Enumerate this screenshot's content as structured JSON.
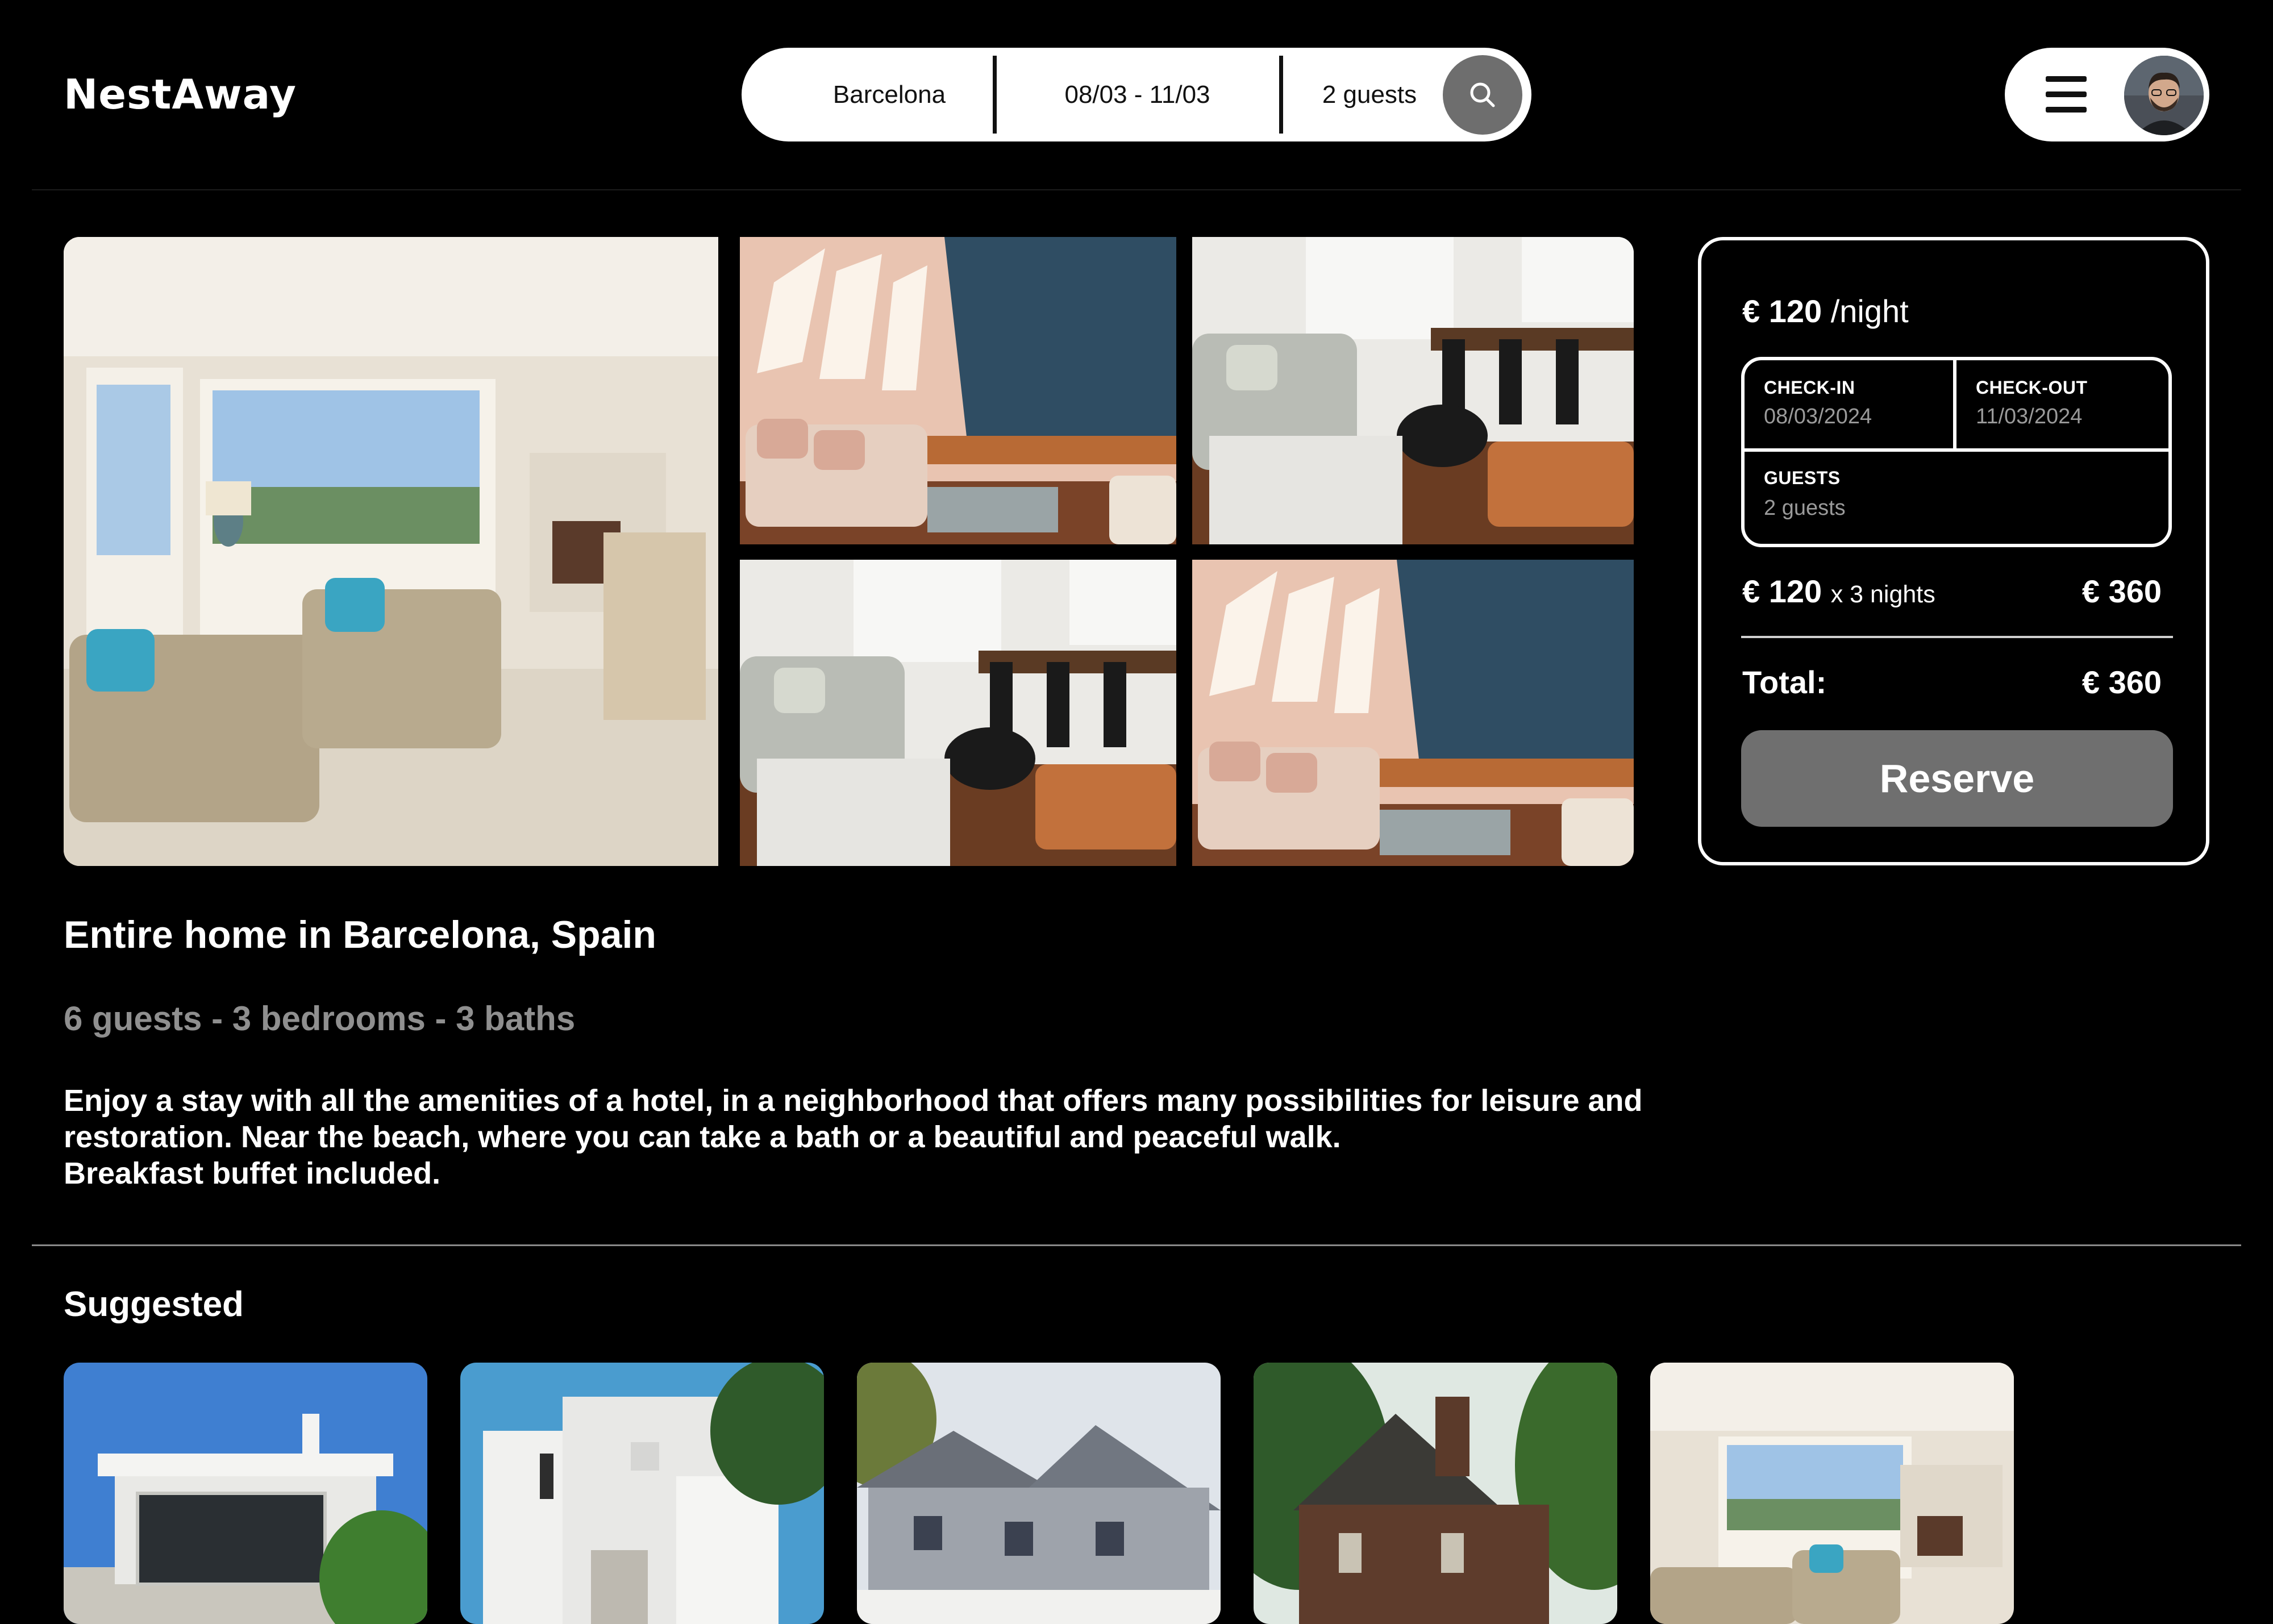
{
  "header": {
    "logo": "NestAway",
    "search": {
      "location": "Barcelona",
      "dates": "08/03 - 11/03",
      "guests": "2 guests"
    }
  },
  "icons": {
    "search": "search-icon",
    "menu": "hamburger-menu-icon",
    "avatar": "user-avatar"
  },
  "gallery": {
    "photos": [
      "living-room-main",
      "attic-lounge",
      "dining-lounge",
      "dining-lounge",
      "attic-lounge"
    ]
  },
  "booking": {
    "price": "€ 120",
    "per_night": "/night",
    "checkin_label": "CHECK-IN",
    "checkin_value": "08/03/2024",
    "checkout_label": "CHECK-OUT",
    "checkout_value": "11/03/2024",
    "guests_label": "GUESTS",
    "guests_value": "2 guests",
    "nightly_price": "€ 120",
    "nights_text": "x 3 nights",
    "subtotal": "€ 360",
    "total_label": "Total:",
    "total_value": "€ 360",
    "reserve_label": "Reserve"
  },
  "listing": {
    "title": "Entire home in Barcelona, Spain",
    "specs": "6 guests - 3 bedrooms - 3 baths",
    "description_lines": [
      "Enjoy a stay with all the amenities of a hotel, in a neighborhood that offers many possibilities for leisure and",
      "restoration. Near the beach, where you can take a bath or a beautiful and peaceful walk.",
      "Breakfast buffet included."
    ]
  },
  "suggested": {
    "title": "Suggested",
    "items": [
      "modern-white-villa",
      "white-cube-house",
      "shingle-house",
      "brick-cottage",
      "living-room"
    ]
  },
  "colors": {
    "background": "#000000",
    "reserve_button": "#6f6f6f",
    "muted_text": "#8f8f8f",
    "search_button": "#6e6e6e"
  }
}
